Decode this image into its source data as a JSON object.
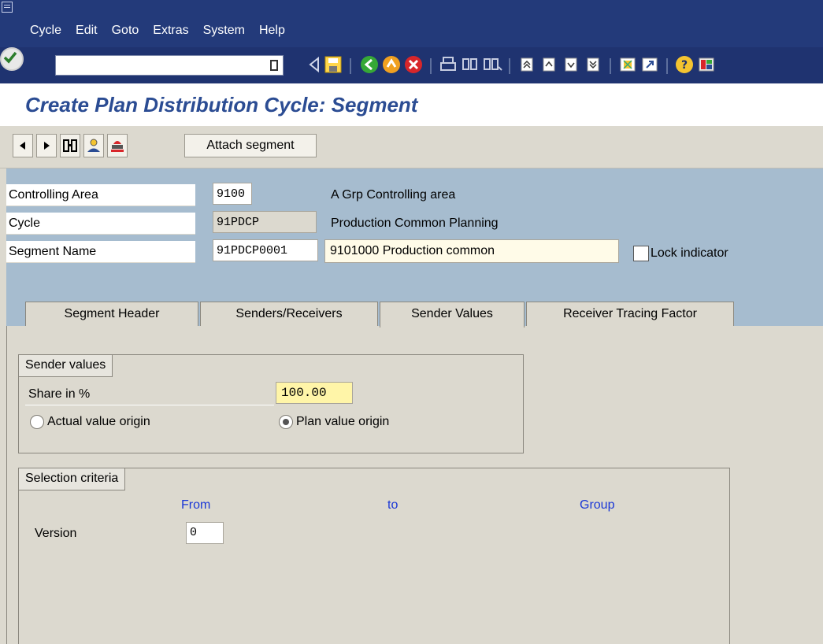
{
  "menubar": {
    "items": [
      "Cycle",
      "Edit",
      "Goto",
      "Extras",
      "System",
      "Help"
    ]
  },
  "toolbar": {
    "command_field": "",
    "icons": [
      "enter-icon",
      "back-nav-icon",
      "save-icon",
      "back-icon",
      "exit-icon",
      "cancel-icon",
      "print-icon",
      "find-icon",
      "find-next-icon",
      "first-page-icon",
      "previous-page-icon",
      "next-page-icon",
      "last-page-icon",
      "create-session-icon",
      "shortcut-icon",
      "help-icon",
      "layout-icon"
    ]
  },
  "page": {
    "title": "Create Plan Distribution Cycle: Segment"
  },
  "app_toolbar": {
    "attach_label": "Attach segment",
    "icons": [
      "previous-icon",
      "next-icon",
      "overview-icon",
      "person-icon",
      "stamp-icon"
    ]
  },
  "header": {
    "controlling_area": {
      "label": "Controlling Area",
      "value": "9100",
      "description": "A Grp Controlling area"
    },
    "cycle": {
      "label": "Cycle",
      "value": "91PDCP",
      "description": "Production Common Planning"
    },
    "segment_name": {
      "label": "Segment Name",
      "value": "91PDCP0001",
      "description": "9101000 Production common"
    },
    "lock_indicator": {
      "label": "Lock indicator",
      "checked": false
    }
  },
  "tabs": [
    {
      "label": "Segment Header",
      "active": false
    },
    {
      "label": "Senders/Receivers",
      "active": false
    },
    {
      "label": "Sender Values",
      "active": true
    },
    {
      "label": "Receiver Tracing Factor",
      "active": false
    }
  ],
  "sender_values": {
    "title": "Sender values",
    "share_label": "Share in %",
    "share_value": "100.00",
    "actual_label": "Actual value origin",
    "plan_label": "Plan value origin",
    "selected": "plan"
  },
  "selection": {
    "title": "Selection criteria",
    "col_from": "From",
    "col_to": "to",
    "col_group": "Group",
    "version_label": "Version",
    "version_from": "0"
  },
  "colors": {
    "menubar_bg": "#233a7a",
    "title_color": "#2b4c93",
    "header_bg": "#a6bccf",
    "panel_bg": "#dcd9cf",
    "active_field": "#fff5a8",
    "column_header": "#1a37d6"
  }
}
